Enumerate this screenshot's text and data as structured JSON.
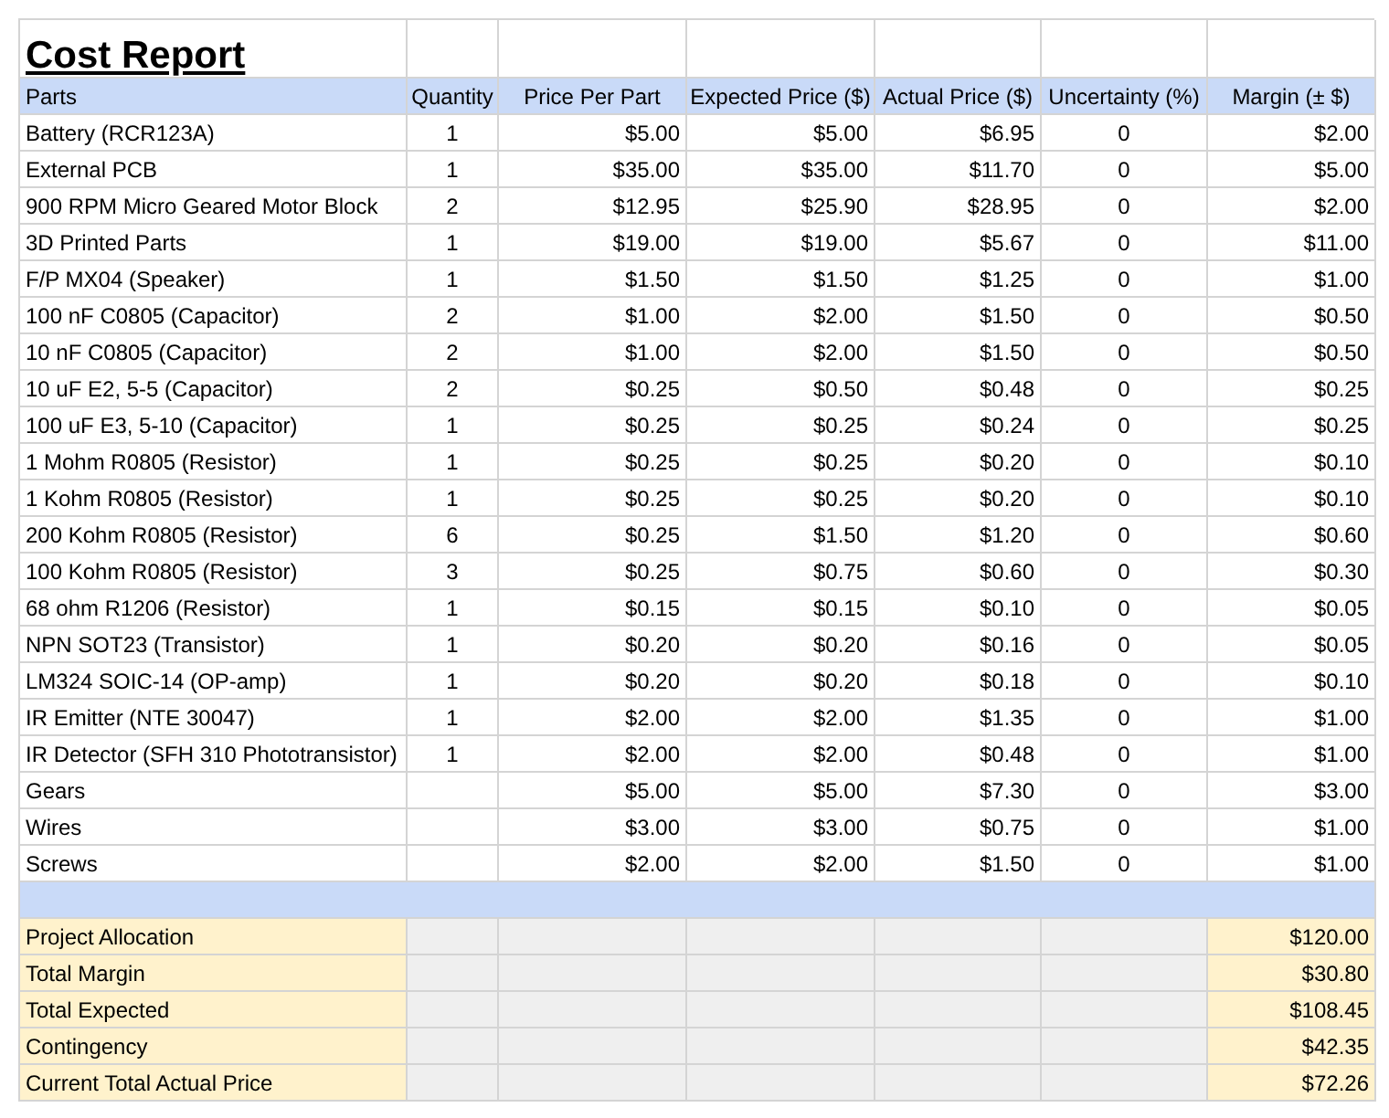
{
  "title": "Cost Report",
  "columns": [
    "Parts",
    "Quantity",
    "Price Per Part",
    "Expected Price ($)",
    "Actual Price ($)",
    "Uncertainty (%)",
    "Margin (± $)"
  ],
  "rows": [
    {
      "part": "Battery (RCR123A)",
      "quantity": "1",
      "price_per_part": "$5.00",
      "expected": "$5.00",
      "actual": "$6.95",
      "uncertainty": "0",
      "margin": "$2.00"
    },
    {
      "part": "External PCB",
      "quantity": "1",
      "price_per_part": "$35.00",
      "expected": "$35.00",
      "actual": "$11.70",
      "uncertainty": "0",
      "margin": "$5.00"
    },
    {
      "part": "900 RPM Micro Geared Motor Block",
      "quantity": "2",
      "price_per_part": "$12.95",
      "expected": "$25.90",
      "actual": "$28.95",
      "uncertainty": "0",
      "margin": "$2.00"
    },
    {
      "part": "3D Printed Parts",
      "quantity": "1",
      "price_per_part": "$19.00",
      "expected": "$19.00",
      "actual": "$5.67",
      "uncertainty": "0",
      "margin": "$11.00"
    },
    {
      "part": "F/P MX04 (Speaker)",
      "quantity": "1",
      "price_per_part": "$1.50",
      "expected": "$1.50",
      "actual": "$1.25",
      "uncertainty": "0",
      "margin": "$1.00"
    },
    {
      "part": "100 nF C0805 (Capacitor)",
      "quantity": "2",
      "price_per_part": "$1.00",
      "expected": "$2.00",
      "actual": "$1.50",
      "uncertainty": "0",
      "margin": "$0.50"
    },
    {
      "part": "10 nF C0805 (Capacitor)",
      "quantity": "2",
      "price_per_part": "$1.00",
      "expected": "$2.00",
      "actual": "$1.50",
      "uncertainty": "0",
      "margin": "$0.50"
    },
    {
      "part": "10 uF E2, 5-5 (Capacitor)",
      "quantity": "2",
      "price_per_part": "$0.25",
      "expected": "$0.50",
      "actual": "$0.48",
      "uncertainty": "0",
      "margin": "$0.25"
    },
    {
      "part": "100 uF E3, 5-10 (Capacitor)",
      "quantity": "1",
      "price_per_part": "$0.25",
      "expected": "$0.25",
      "actual": "$0.24",
      "uncertainty": "0",
      "margin": "$0.25"
    },
    {
      "part": "1 Mohm R0805 (Resistor)",
      "quantity": "1",
      "price_per_part": "$0.25",
      "expected": "$0.25",
      "actual": "$0.20",
      "uncertainty": "0",
      "margin": "$0.10"
    },
    {
      "part": "1 Kohm R0805 (Resistor)",
      "quantity": "1",
      "price_per_part": "$0.25",
      "expected": "$0.25",
      "actual": "$0.20",
      "uncertainty": "0",
      "margin": "$0.10"
    },
    {
      "part": "200 Kohm R0805 (Resistor)",
      "quantity": "6",
      "price_per_part": "$0.25",
      "expected": "$1.50",
      "actual": "$1.20",
      "uncertainty": "0",
      "margin": "$0.60"
    },
    {
      "part": "100 Kohm R0805 (Resistor)",
      "quantity": "3",
      "price_per_part": "$0.25",
      "expected": "$0.75",
      "actual": "$0.60",
      "uncertainty": "0",
      "margin": "$0.30"
    },
    {
      "part": "68 ohm R1206 (Resistor)",
      "quantity": "1",
      "price_per_part": "$0.15",
      "expected": "$0.15",
      "actual": "$0.10",
      "uncertainty": "0",
      "margin": "$0.05"
    },
    {
      "part": "NPN SOT23 (Transistor)",
      "quantity": "1",
      "price_per_part": "$0.20",
      "expected": "$0.20",
      "actual": "$0.16",
      "uncertainty": "0",
      "margin": "$0.05"
    },
    {
      "part": "LM324 SOIC-14 (OP-amp)",
      "quantity": "1",
      "price_per_part": "$0.20",
      "expected": "$0.20",
      "actual": "$0.18",
      "uncertainty": "0",
      "margin": "$0.10"
    },
    {
      "part": "IR Emitter (NTE 30047)",
      "quantity": "1",
      "price_per_part": "$2.00",
      "expected": "$2.00",
      "actual": "$1.35",
      "uncertainty": "0",
      "margin": "$1.00"
    },
    {
      "part": "IR Detector (SFH 310 Phototransistor)",
      "quantity": "1",
      "price_per_part": "$2.00",
      "expected": "$2.00",
      "actual": "$0.48",
      "uncertainty": "0",
      "margin": "$1.00"
    },
    {
      "part": "Gears",
      "price_per_part": "$5.00",
      "expected": "$5.00",
      "actual": "$7.30",
      "uncertainty": "0",
      "margin": "$3.00"
    },
    {
      "part": "Wires",
      "price_per_part": "$3.00",
      "expected": "$3.00",
      "actual": "$0.75",
      "uncertainty": "0",
      "margin": "$1.00"
    },
    {
      "part": "Screws",
      "price_per_part": "$2.00",
      "expected": "$2.00",
      "actual": "$1.50",
      "uncertainty": "0",
      "margin": "$1.00"
    }
  ],
  "summary": [
    {
      "label": "Project Allocation",
      "value": "$120.00"
    },
    {
      "label": "Total Margin",
      "value": "$30.80"
    },
    {
      "label": "Total Expected",
      "value": "$108.45"
    },
    {
      "label": "Contingency",
      "value": "$42.35"
    },
    {
      "label": "Current Total Actual Price",
      "value": "$72.26"
    }
  ]
}
